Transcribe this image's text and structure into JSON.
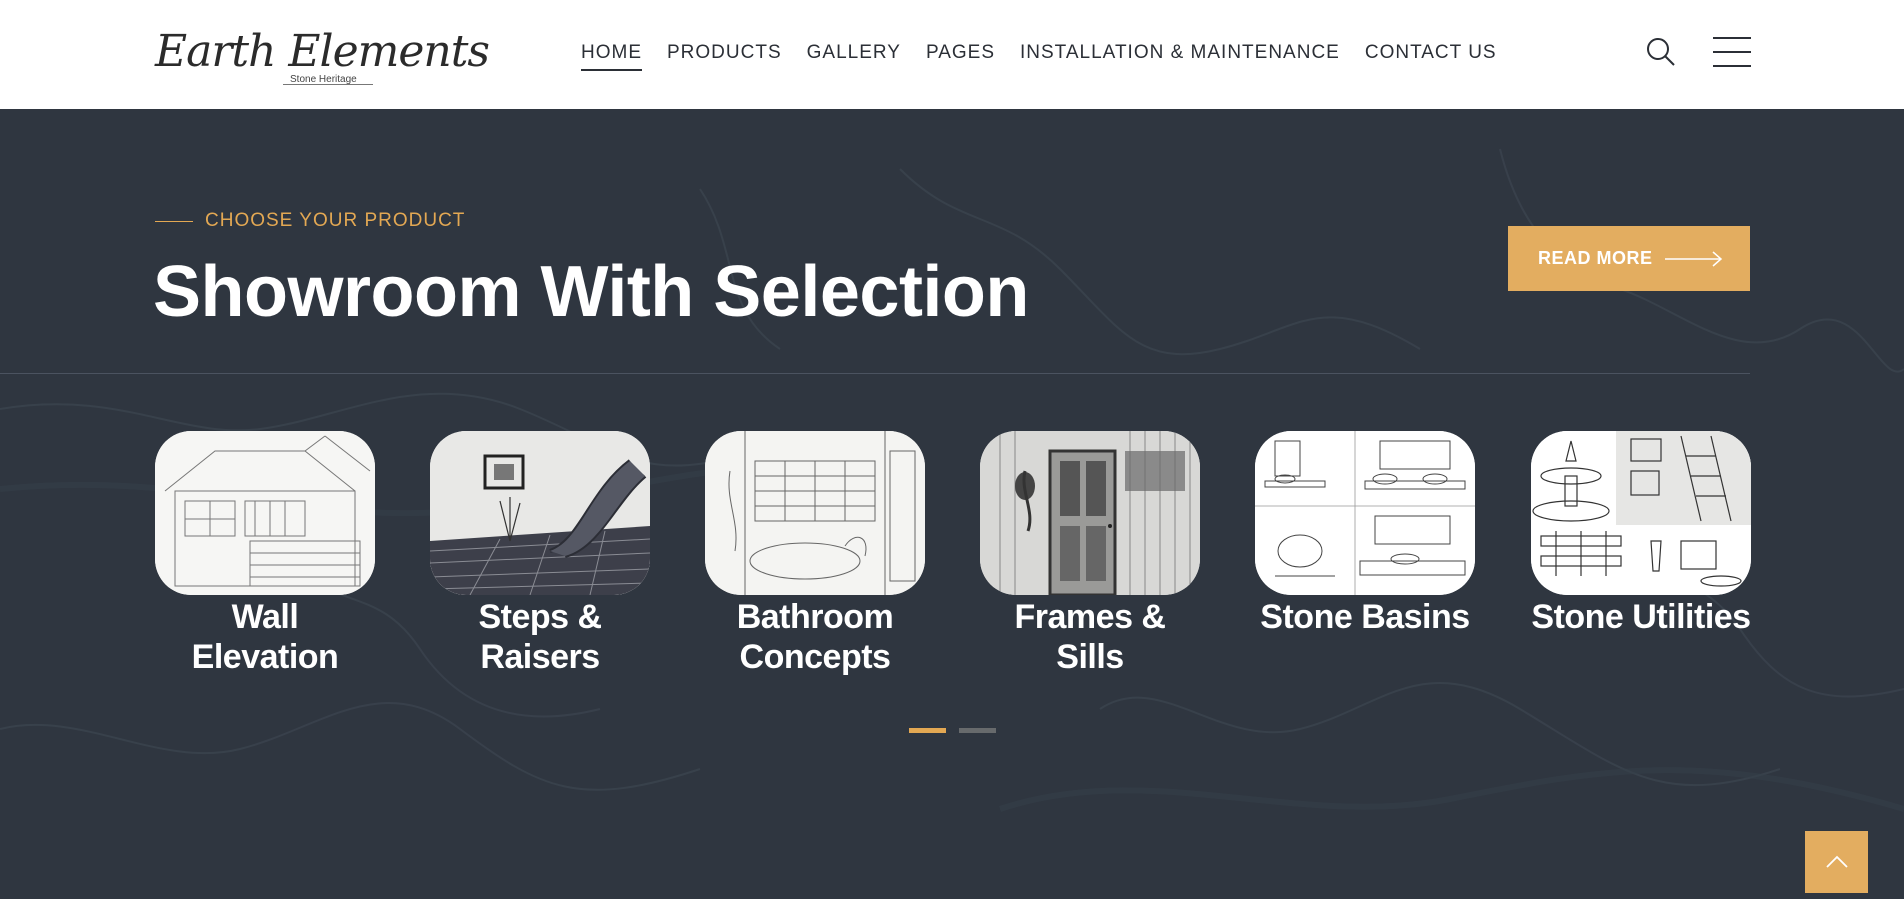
{
  "brand": {
    "name": "Earth Elements",
    "tagline": "Stone Heritage"
  },
  "nav": {
    "items": [
      "HOME",
      "PRODUCTS",
      "GALLERY",
      "PAGES",
      "INSTALLATION & MAINTENANCE",
      "CONTACT US"
    ],
    "active": "HOME"
  },
  "icons": {
    "search": "search-icon",
    "menu": "hamburger-menu-icon",
    "cta_arrow": "arrow-right-icon",
    "scroll_top": "chevron-up-icon"
  },
  "hero": {
    "eyebrow": "CHOOSE YOUR PRODUCT",
    "heading": "Showroom With Selection",
    "cta_label": "READ MORE"
  },
  "products": [
    {
      "label": "Wall Elevation",
      "image": "sketch of house wall elevation"
    },
    {
      "label": "Steps & Raisers",
      "image": "sketch of curved staircase"
    },
    {
      "label": "Bathroom Concepts",
      "image": "sketch of bathroom interior"
    },
    {
      "label": "Frames & Sills",
      "image": "sketch of door frame"
    },
    {
      "label": "Stone Basins",
      "image": "sketches of wash basins"
    },
    {
      "label": "Stone Utilities",
      "image": "sketches of fountain and shelves"
    }
  ],
  "carousel": {
    "pages": 2,
    "active_page": 1
  },
  "colors": {
    "accent": "#e3ad60",
    "section_bg": "#2f3640",
    "header_bg": "#ffffff",
    "text_dark": "#2b2f36"
  }
}
